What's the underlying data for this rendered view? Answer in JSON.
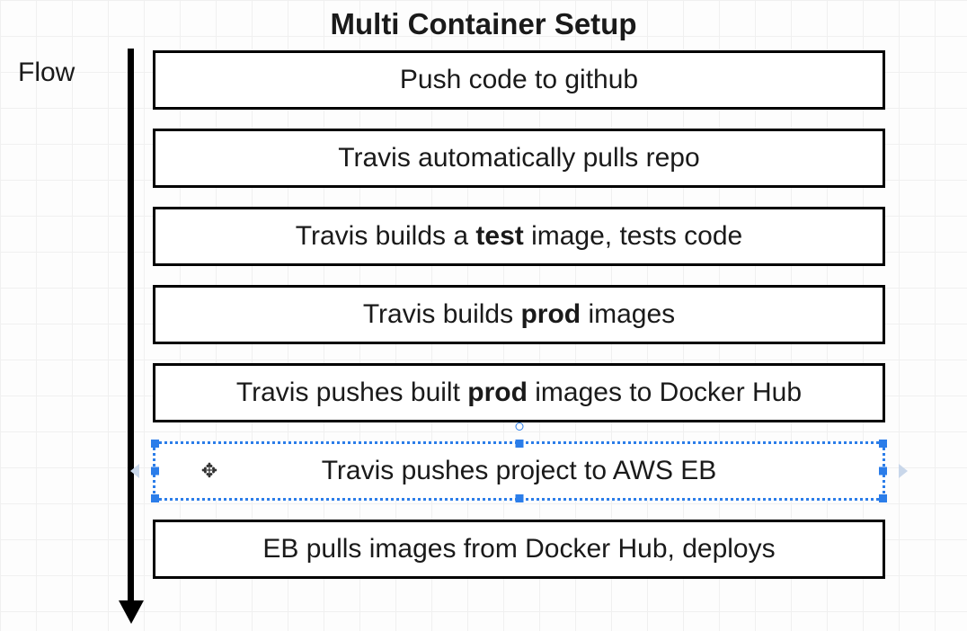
{
  "title": "Multi Container Setup",
  "flow_label": "Flow",
  "steps": [
    {
      "html": "Push code to github",
      "selected": false
    },
    {
      "html": "Travis automatically pulls repo",
      "selected": false
    },
    {
      "html": "Travis builds a <b>test</b> image, tests code",
      "selected": false
    },
    {
      "html": "Travis builds <b>prod</b> images",
      "selected": false
    },
    {
      "html": "Travis pushes built <b>prod</b> images to Docker Hub",
      "selected": false
    },
    {
      "html": "Travis pushes project to AWS EB",
      "selected": true
    },
    {
      "html": "EB pulls images from Docker Hub, deploys",
      "selected": false
    }
  ]
}
